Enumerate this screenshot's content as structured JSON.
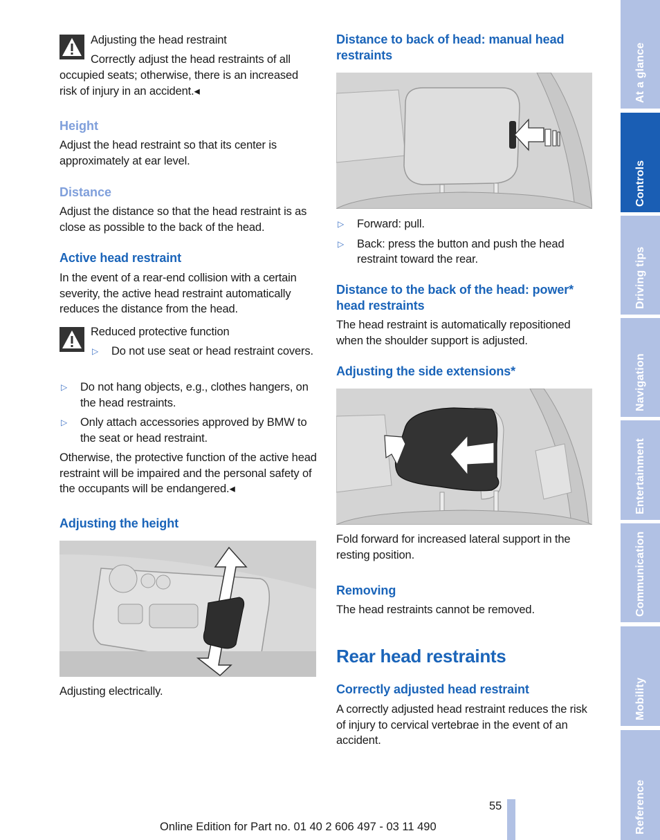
{
  "left": {
    "warning1": {
      "icon": "warning-triangle-icon",
      "title": "Adjusting the head restraint",
      "text_first": "Correctly adjust the head restraints of all",
      "text_rest": "occupied seats; otherwise, there is an increased risk of injury in an accident.◂"
    },
    "height": {
      "heading": "Height",
      "text": "Adjust the head restraint so that its center is approximately at ear level."
    },
    "distance": {
      "heading": "Distance",
      "text": "Adjust the distance so that the head restraint is as close as possible to the back of the head."
    },
    "active": {
      "heading": "Active head restraint",
      "text": "In the event of a rear-end collision with a certain severity, the active head restraint automatically reduces the distance from the head."
    },
    "warning2": {
      "icon": "warning-triangle-icon",
      "title": "Reduced protective function",
      "bullet": "Do not use seat or head restraint covers."
    },
    "bullets": [
      "Do not hang objects, e.g., clothes hangers, on the head restraints.",
      "Only attach accessories approved by BMW to the seat or head restraint."
    ],
    "otherwise": "Otherwise, the protective function of the active head restraint will be impaired and the personal safety of the occupants will be endangered.◂",
    "adjusting_height": {
      "heading": "Adjusting the height",
      "figure": "seat-control-switch-illustration",
      "caption": "Adjusting electrically."
    }
  },
  "right": {
    "manual": {
      "heading": "Distance to back of head: manual head restraints",
      "figure": "manual-head-restraint-illustration",
      "bullets": [
        "Forward: pull.",
        "Back: press the button and push the head restraint toward the rear."
      ]
    },
    "power": {
      "heading": "Distance to the back of the head: power* head restraints",
      "text": "The head restraint is automatically repositioned when the shoulder support is adjusted."
    },
    "side": {
      "heading": "Adjusting the side extensions*",
      "figure": "side-extensions-illustration",
      "text": "Fold forward for increased lateral support in the resting position."
    },
    "removing": {
      "heading": "Removing",
      "text": "The head restraints cannot be removed."
    },
    "rear": {
      "title": "Rear head restraints",
      "subheading": "Correctly adjusted head restraint",
      "text": "A correctly adjusted head restraint reduces the risk of injury to cervical vertebrae in the event of an accident."
    }
  },
  "bullet_glyph": "▷",
  "sidebar": {
    "tabs": [
      {
        "label": "At a glance",
        "active": false
      },
      {
        "label": "Controls",
        "active": true
      },
      {
        "label": "Driving tips",
        "active": false
      },
      {
        "label": "Navigation",
        "active": false
      },
      {
        "label": "Entertainment",
        "active": false
      },
      {
        "label": "Communication",
        "active": false
      },
      {
        "label": "Mobility",
        "active": false
      },
      {
        "label": "Reference",
        "active": false
      }
    ]
  },
  "footer": {
    "page_number": "55",
    "edition": "Online Edition for Part no. 01 40 2 606 497 - 03 11 490"
  },
  "colors": {
    "heading_blue": "#1a64b9",
    "heading_light": "#7f9fdb",
    "tab_inactive": "#b1c1e4",
    "tab_active": "#1a5eb4"
  }
}
